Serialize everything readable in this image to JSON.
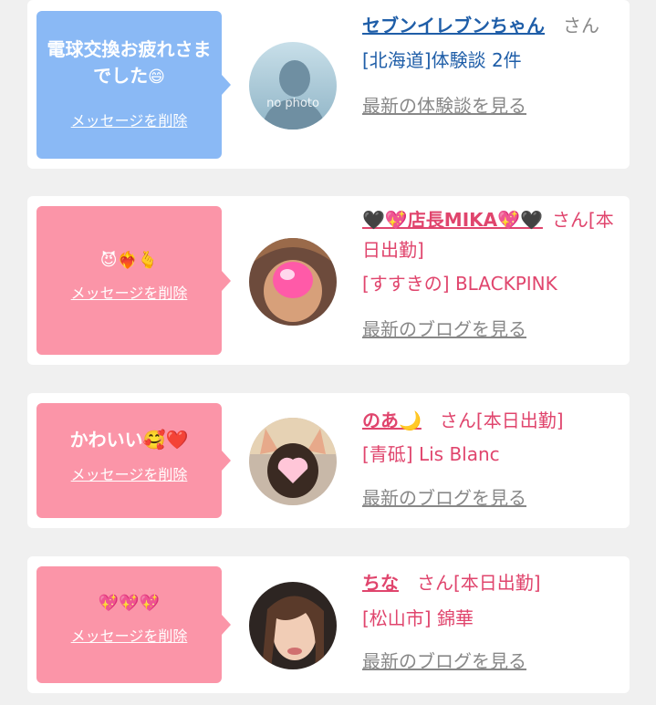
{
  "cards": [
    {
      "message": "電球交換お疲れさまでした",
      "emoji": "😄",
      "delete_label": "メッセージを削除",
      "name": "セブンイレブンちゃん",
      "honorific": "さん",
      "location": "[北海道]体験談 2件",
      "more_label": "最新の体験談を見る",
      "avatar_text": "no photo"
    },
    {
      "message": "😈❤️‍🔥🫰",
      "delete_label": "メッセージを削除",
      "name": "🖤💖店長MIKA💖🖤",
      "honorific": "さん[本日出勤]",
      "location": "[すすきの] BLACKPINK",
      "more_label": "最新のブログを見る"
    },
    {
      "message": "かわいい🥰❤️",
      "delete_label": "メッセージを削除",
      "name": "のあ🌙",
      "honorific": "さん[本日出勤]",
      "location": "[青砥] Lis Blanc",
      "more_label": "最新のブログを見る"
    },
    {
      "message": "💖💖💖",
      "delete_label": "メッセージを削除",
      "name": "ちな",
      "honorific": "さん[本日出勤]",
      "location": "[松山市] 錦華",
      "more_label": "最新のブログを見る"
    }
  ]
}
